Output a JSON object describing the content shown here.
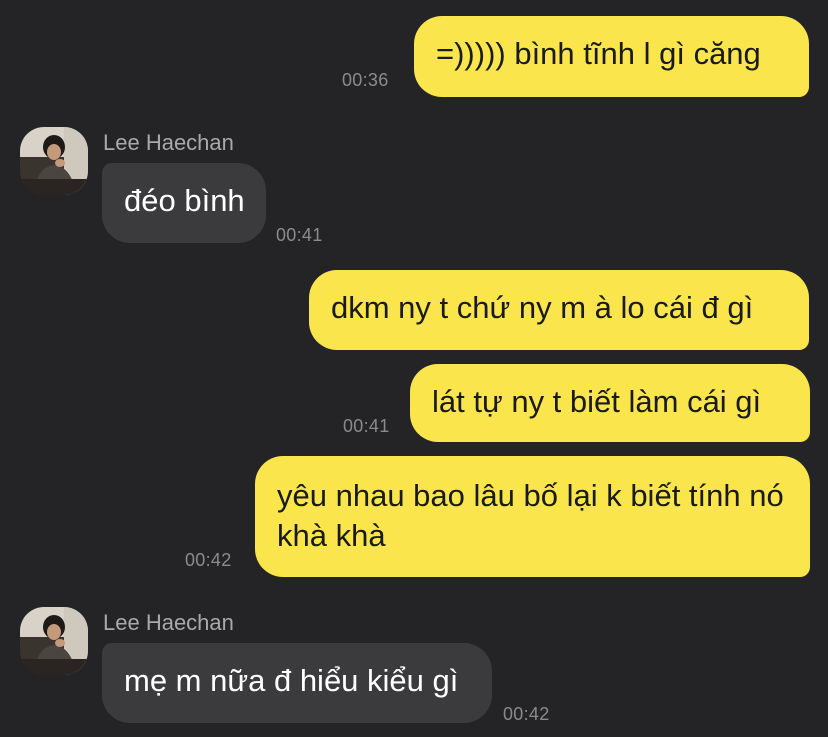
{
  "messages": [
    {
      "text": "=))))) bình tĩnh l gì căng",
      "time": "00:36"
    },
    {
      "sender": "Lee Haechan",
      "text": "đéo bình",
      "time": "00:41"
    },
    {
      "text": "dkm ny t chứ ny m à lo cái đ gì"
    },
    {
      "text": "lát tự ny t biết làm cái gì",
      "time": "00:41"
    },
    {
      "text": "yêu nhau bao lâu bố lại k biết tính nó khà khà",
      "time": "00:42"
    },
    {
      "sender": "Lee Haechan",
      "text": "mẹ m nữa đ hiểu kiểu gì",
      "time": "00:42"
    }
  ],
  "colors": {
    "background": "#242427",
    "outgoing_bubble": "#FAE64C",
    "incoming_bubble": "#3B3B3E",
    "timestamp": "#8B8B8E",
    "sender_name": "#A9A9AC"
  },
  "avatar_icon": "profile-photo"
}
